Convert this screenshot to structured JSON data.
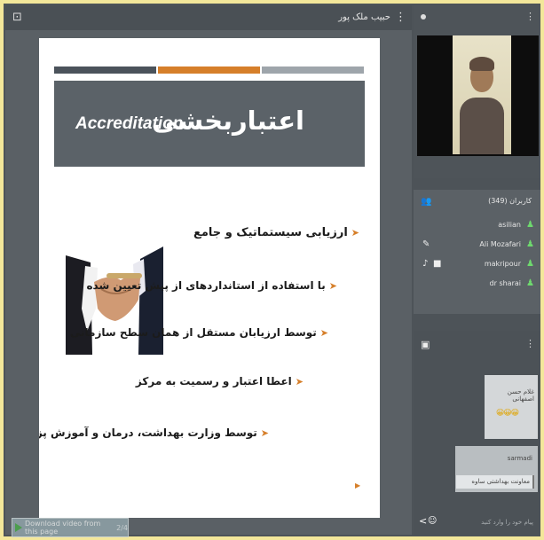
{
  "presentation": {
    "presenter_name": "حبیب ملک پور",
    "slide": {
      "title_en": "Accreditation",
      "title_fa": "اعتباربخشی",
      "bullets": [
        "ارزیابی سیستماتیک و جامع",
        "با استفاده از استانداردهای از پیش تعیین شده",
        "توسط ارزیابان مستقل از همان سطح سازمانی",
        "اعطا اعتبار و رسمیت به مرکز",
        "توسط وزارت بهداشت، درمان و آموزش پزشکی"
      ]
    },
    "download_label": "Download video from this page",
    "download_ratio": "2/4"
  },
  "users": {
    "title": "کاربران (349)",
    "list": [
      "asilian",
      "Ali Mozafari",
      "makripour",
      "dr sharai"
    ]
  },
  "chat": {
    "messages": [
      {
        "sender": "غلام حسن اصفهانی",
        "text": "😀😀😀"
      },
      {
        "sender": "sarmadi",
        "text": "معاونت بهداشتی ساوه"
      }
    ],
    "placeholder": "پیام خود را وارد کنید"
  },
  "colors": {
    "accent_orange": "#d67f2a",
    "banner_gray": "#5b6268",
    "online_green": "#6ed86e",
    "outer_border": "#f3e79a"
  }
}
